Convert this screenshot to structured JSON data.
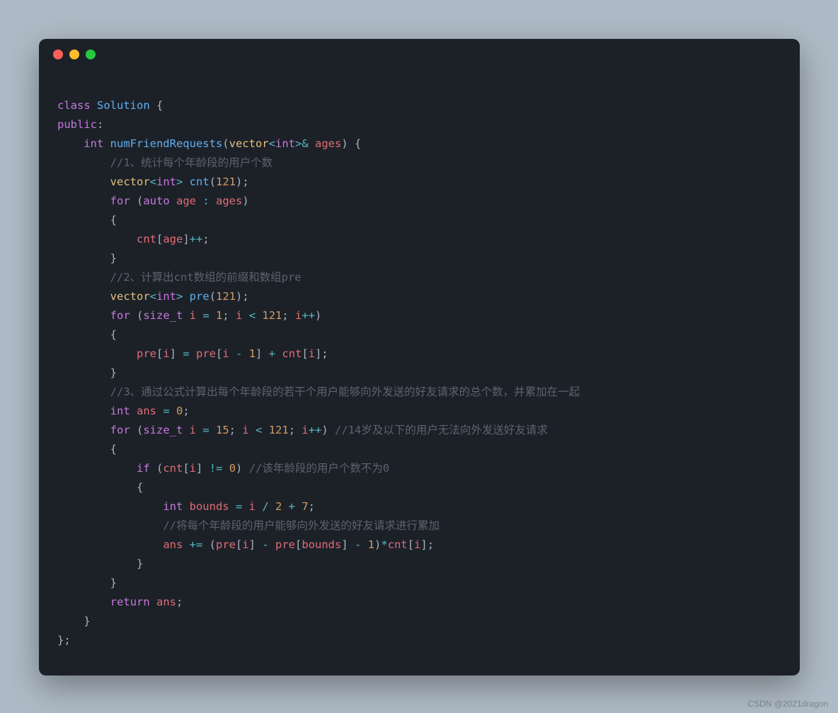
{
  "window": {
    "dots": [
      "red",
      "yellow",
      "green"
    ]
  },
  "code": {
    "l1": {
      "a": "class ",
      "b": "Solution",
      "c": " {"
    },
    "l2": {
      "a": "public",
      "b": ":"
    },
    "l3": {
      "a": "    ",
      "b": "int ",
      "c": "numFriendRequests",
      "d": "(",
      "e": "vector",
      "f": "<",
      "g": "int",
      "h": ">&",
      "i": " ages",
      "j": ") {"
    },
    "l4": {
      "a": "        ",
      "b": "//1、统计每个年龄段的用户个数"
    },
    "l5": {
      "a": "        ",
      "b": "vector",
      "c": "<",
      "d": "int",
      "e": "> ",
      "f": "cnt",
      "g": "(",
      "h": "121",
      "i": ");"
    },
    "l6": {
      "a": "        ",
      "b": "for ",
      "c": "(",
      "d": "auto ",
      "e": "age ",
      "f": ": ",
      "g": "ages",
      "h": ")"
    },
    "l7": {
      "a": "        {"
    },
    "l8": {
      "a": "            ",
      "b": "cnt",
      "c": "[",
      "d": "age",
      "e": "]",
      "f": "++",
      "g": ";"
    },
    "l9": {
      "a": "        }"
    },
    "l10": {
      "a": "        ",
      "b": "//2、计算出cnt数组的前缀和数组pre"
    },
    "l11": {
      "a": "        ",
      "b": "vector",
      "c": "<",
      "d": "int",
      "e": "> ",
      "f": "pre",
      "g": "(",
      "h": "121",
      "i": ");"
    },
    "l12": {
      "a": "        ",
      "b": "for ",
      "c": "(",
      "d": "size_t ",
      "e": "i ",
      "f": "= ",
      "g": "1",
      "h": "; ",
      "i": "i ",
      "j": "< ",
      "k": "121",
      "l": "; ",
      "m": "i",
      "n": "++",
      "o": ")"
    },
    "l13": {
      "a": "        {"
    },
    "l14": {
      "a": "            ",
      "b": "pre",
      "c": "[",
      "d": "i",
      "e": "] ",
      "f": "= ",
      "g": "pre",
      "h": "[",
      "i": "i ",
      "j": "- ",
      "k": "1",
      "l": "] ",
      "m": "+ ",
      "n": "cnt",
      "o": "[",
      "p": "i",
      "q": "];"
    },
    "l15": {
      "a": "        }"
    },
    "l16": {
      "a": "        ",
      "b": "//3、通过公式计算出每个年龄段的若干个用户能够向外发送的好友请求的总个数，并累加在一起"
    },
    "l17": {
      "a": "        ",
      "b": "int ",
      "c": "ans ",
      "d": "= ",
      "e": "0",
      "f": ";"
    },
    "l18": {
      "a": "        ",
      "b": "for ",
      "c": "(",
      "d": "size_t ",
      "e": "i ",
      "f": "= ",
      "g": "15",
      "h": "; ",
      "i": "i ",
      "j": "< ",
      "k": "121",
      "l": "; ",
      "m": "i",
      "n": "++",
      "o": ") ",
      "p": "//14岁及以下的用户无法向外发送好友请求"
    },
    "l19": {
      "a": "        {"
    },
    "l20": {
      "a": "            ",
      "b": "if ",
      "c": "(",
      "d": "cnt",
      "e": "[",
      "f": "i",
      "g": "] ",
      "h": "!= ",
      "i": "0",
      "j": ") ",
      "k": "//该年龄段的用户个数不为0"
    },
    "l21": {
      "a": "            {"
    },
    "l22": {
      "a": "                ",
      "b": "int ",
      "c": "bounds ",
      "d": "= ",
      "e": "i ",
      "f": "/ ",
      "g": "2 ",
      "h": "+ ",
      "i": "7",
      "j": ";"
    },
    "l23": {
      "a": "                ",
      "b": "//将每个年龄段的用户能够向外发送的好友请求进行累加"
    },
    "l24": {
      "a": "                ",
      "b": "ans ",
      "c": "+= ",
      "d": "(",
      "e": "pre",
      "f": "[",
      "g": "i",
      "h": "] ",
      "i": "- ",
      "j": "pre",
      "k": "[",
      "l": "bounds",
      "m": "] ",
      "n": "- ",
      "o": "1",
      "p": ")",
      "q": "*",
      "r": "cnt",
      "s": "[",
      "t": "i",
      "u": "];"
    },
    "l25": {
      "a": "            }"
    },
    "l26": {
      "a": "        }"
    },
    "l27": {
      "a": "        ",
      "b": "return ",
      "c": "ans",
      "d": ";"
    },
    "l28": {
      "a": "    }"
    },
    "l29": {
      "a": "};"
    }
  },
  "watermark": "CSDN @2021dragon"
}
